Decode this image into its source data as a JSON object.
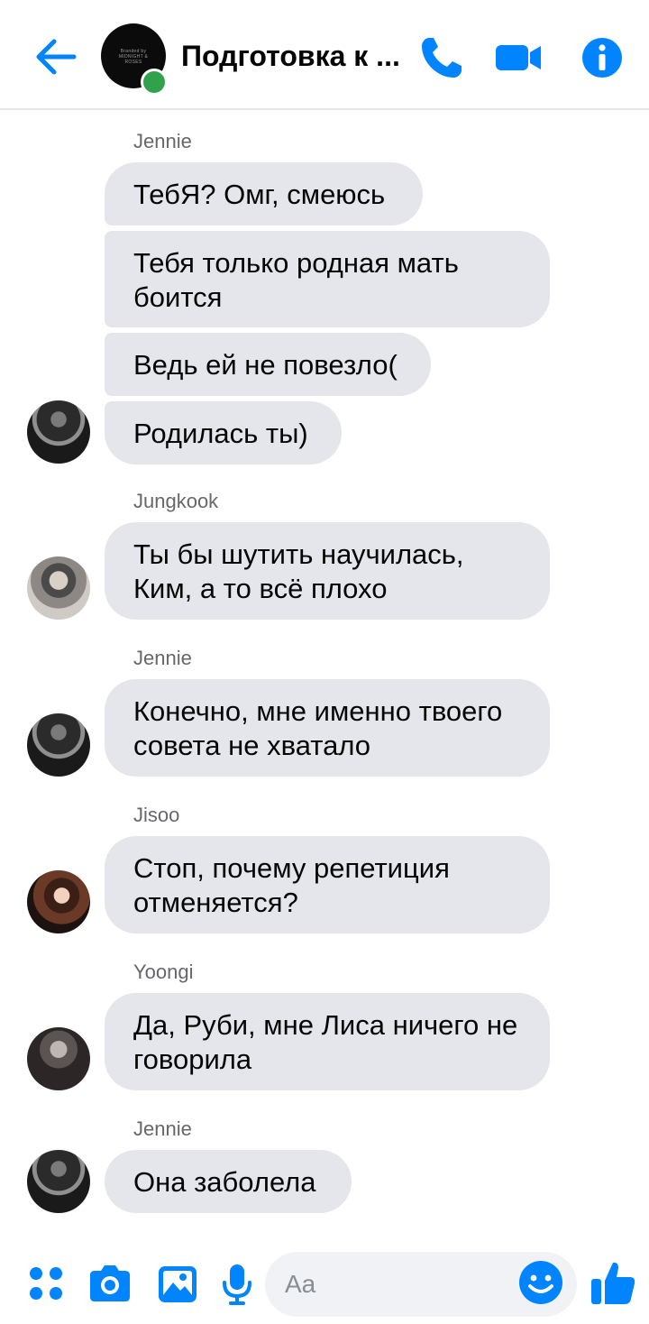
{
  "header": {
    "title": "Подготовка к ...",
    "avatar_logo_text": "Branded by\nMIDNIGHT & ROSES"
  },
  "messages": [
    {
      "sender": "Jennie",
      "texts": [
        "ТебЯ? Омг, смеюсь",
        "Тебя только родная мать\nбоится",
        "Ведь ей не повезло(",
        "Родилась ты)"
      ]
    },
    {
      "sender": "Jungkook",
      "texts": [
        "Ты бы шутить научилась,\nКим, а то всё плохо"
      ]
    },
    {
      "sender": "Jennie",
      "texts": [
        "Конечно, мне именно твоего\nсовета не хватало"
      ]
    },
    {
      "sender": "Jisoo",
      "texts": [
        "Стоп, почему репетиция\nотменяется?"
      ]
    },
    {
      "sender": "Yoongi",
      "texts": [
        "Да, Руби, мне Лиса ничего не\nговорила"
      ]
    },
    {
      "sender": "Jennie",
      "texts": [
        "Она заболела"
      ]
    }
  ],
  "composer": {
    "placeholder": "Aa"
  },
  "colors": {
    "accent": "#0084ff",
    "bubble": "#e4e6eb",
    "online": "#31a24c"
  }
}
